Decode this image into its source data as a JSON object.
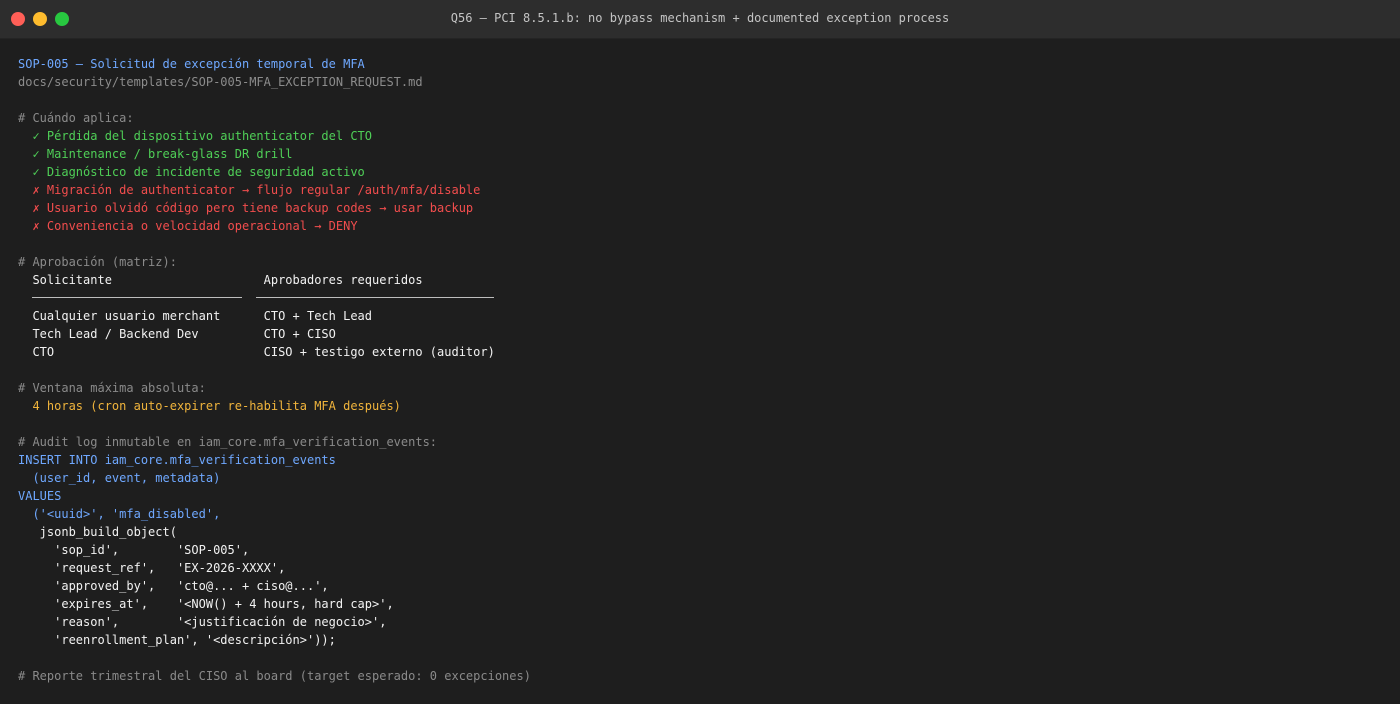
{
  "window": {
    "title": "Q56 — PCI 8.5.1.b: no bypass mechanism + documented exception process"
  },
  "terminal": {
    "lines": [
      {
        "text": "SOP-005 — Solicitud de excepción temporal de MFA",
        "kind": "title"
      },
      {
        "text": "docs/security/templates/SOP-005-MFA_EXCEPTION_REQUEST.md",
        "kind": "path"
      },
      {
        "text": "",
        "kind": "blank"
      },
      {
        "text": "# Cuándo aplica:",
        "kind": "comment"
      },
      {
        "text": "  ✓ Pérdida del dispositivo authenticator del CTO",
        "kind": "ok"
      },
      {
        "text": "  ✓ Maintenance / break-glass DR drill",
        "kind": "ok"
      },
      {
        "text": "  ✓ Diagnóstico de incidente de seguridad activo",
        "kind": "ok"
      },
      {
        "text": "  ✗ Migración de authenticator → flujo regular /auth/mfa/disable",
        "kind": "bad"
      },
      {
        "text": "  ✗ Usuario olvidó código pero tiene backup codes → usar backup",
        "kind": "bad"
      },
      {
        "text": "  ✗ Conveniencia o velocidad operacional → DENY",
        "kind": "bad"
      },
      {
        "text": "",
        "kind": "blank"
      },
      {
        "text": "# Aprobación (matriz):",
        "kind": "comment"
      },
      {
        "text": "  Solicitante                     Aprobadores requeridos",
        "kind": "white"
      },
      {
        "text": "",
        "kind": "divider"
      },
      {
        "text": "  Cualquier usuario merchant      CTO + Tech Lead",
        "kind": "white"
      },
      {
        "text": "  Tech Lead / Backend Dev         CTO + CISO",
        "kind": "white"
      },
      {
        "text": "  CTO                             CISO + testigo externo (auditor)",
        "kind": "white"
      },
      {
        "text": "",
        "kind": "blank"
      },
      {
        "text": "# Ventana máxima absoluta:",
        "kind": "comment"
      },
      {
        "text": "  4 horas (cron auto-expirer re-habilita MFA después)",
        "kind": "warn"
      },
      {
        "text": "",
        "kind": "blank"
      },
      {
        "text": "# Audit log inmutable en iam_core.mfa_verification_events:",
        "kind": "comment"
      },
      {
        "text": "INSERT INTO iam_core.mfa_verification_events",
        "kind": "sql"
      },
      {
        "text": "  (user_id, event, metadata)",
        "kind": "sql"
      },
      {
        "text": "VALUES",
        "kind": "sql"
      },
      {
        "text": "  ('<uuid>', 'mfa_disabled',",
        "kind": "sql"
      },
      {
        "text": "   jsonb_build_object(",
        "kind": "white"
      },
      {
        "text": "     'sop_id',        'SOP-005',",
        "kind": "white"
      },
      {
        "text": "     'request_ref',   'EX-2026-XXXX',",
        "kind": "white"
      },
      {
        "text": "     'approved_by',   'cto@... + ciso@...',",
        "kind": "white"
      },
      {
        "text": "     'expires_at',    '<NOW() + 4 hours, hard cap>',",
        "kind": "white"
      },
      {
        "text": "     'reason',        '<justificación de negocio>',",
        "kind": "white"
      },
      {
        "text": "     'reenrollment_plan', '<descripción>'));",
        "kind": "white"
      },
      {
        "text": "",
        "kind": "blank"
      },
      {
        "text": "# Reporte trimestral del CISO al board (target esperado: 0 excepciones)",
        "kind": "comment"
      }
    ]
  },
  "colors": {
    "background": "#1e1e1e",
    "titlebar": "#2d2d2d",
    "title": "#6fa8ff",
    "ok": "#4fcf57",
    "bad": "#f24d4d",
    "warn": "#f0b43c",
    "comment": "#8a8a8a"
  }
}
